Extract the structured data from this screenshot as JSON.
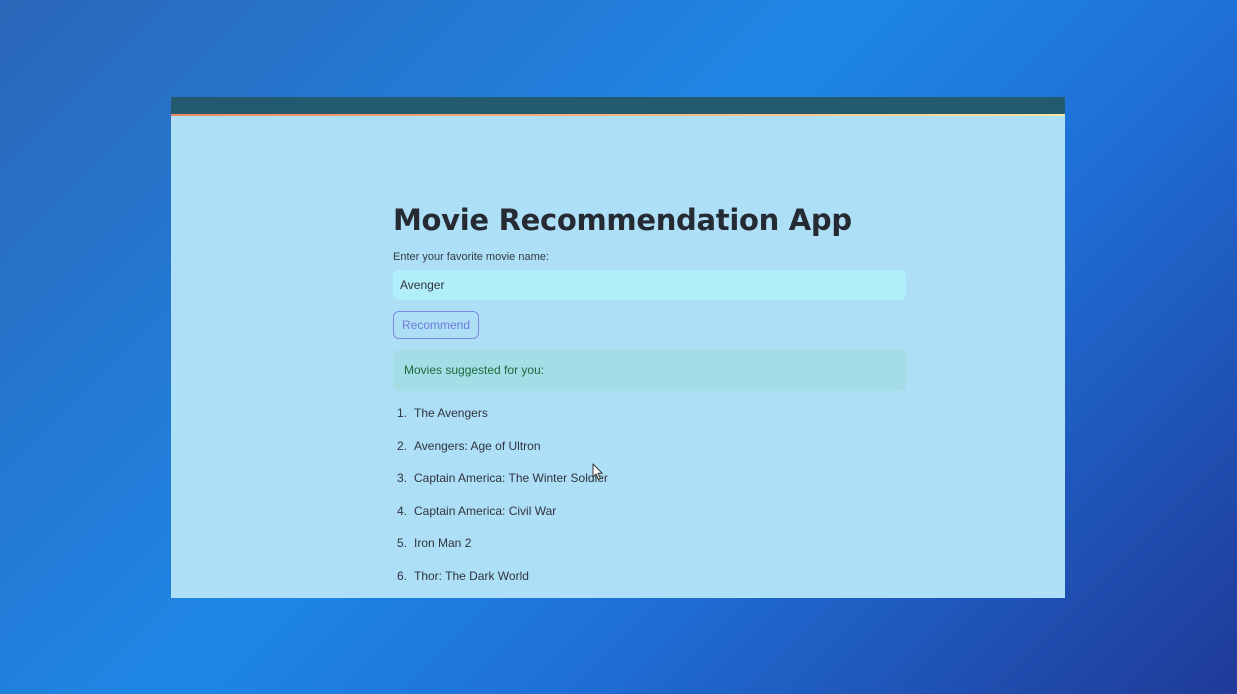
{
  "app": {
    "title": "Movie Recommendation App",
    "input_label": "Enter your favorite movie name:",
    "input_value": "Avenger",
    "button_label": "Recommend",
    "success_message": "Movies suggested for you:"
  },
  "movies": [
    {
      "num": "1.",
      "title": "The Avengers"
    },
    {
      "num": "2.",
      "title": "Avengers: Age of Ultron"
    },
    {
      "num": "3.",
      "title": "Captain America: The Winter Soldier"
    },
    {
      "num": "4.",
      "title": "Captain America: Civil War"
    },
    {
      "num": "5.",
      "title": "Iron Man 2"
    },
    {
      "num": "6.",
      "title": "Thor: The Dark World"
    }
  ],
  "icons": {
    "cursor": "mouse-pointer-icon"
  },
  "colors": {
    "background": "#1e87e6",
    "app_background": "#addff7",
    "header_bar": "#245a70",
    "title_text": "#262b33",
    "input_background": "#b0eef9",
    "button_border": "#7c8ae6",
    "success_background": "#a4dde6",
    "success_text": "#1c6b3c"
  }
}
